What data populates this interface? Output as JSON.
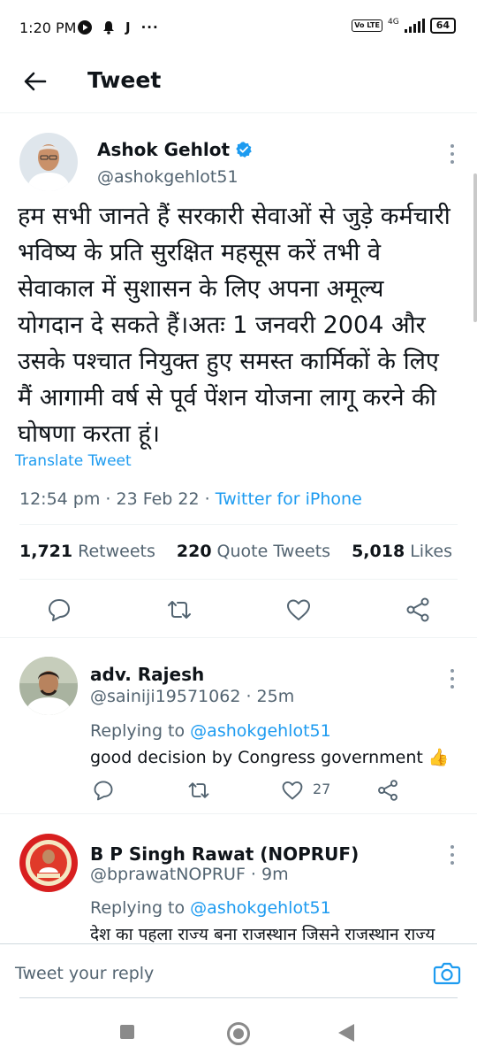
{
  "status_bar": {
    "time": "1:20 PM",
    "left_icons": [
      "play-icon",
      "bell-icon",
      "j-icon",
      "more-dots"
    ],
    "j_glyph": "J",
    "dots": "···",
    "network": "4G",
    "volte": "Vo LTE",
    "battery": "64"
  },
  "header": {
    "title": "Tweet"
  },
  "main_tweet": {
    "author_name": "Ashok Gehlot",
    "handle": "@ashokgehlot51",
    "verified": true,
    "text": "हम सभी जानते हैं सरकारी सेवाओं से जुड़े कर्मचारी भविष्य के प्रति सुरक्षित महसूस करें तभी वे सेवाकाल में सुशासन के लिए अपना अमूल्य योगदान दे सकते हैं।अतः 1 जनवरी 2004 और उसके पश्चात नियुक्त हुए समस्त कार्मिकों के लिए मैं आगामी वर्ष से पूर्व पेंशन योजना लागू करने की घोषणा करता हूं।",
    "translate_label": "Translate Tweet",
    "time": "12:54 pm",
    "date": "23 Feb 22",
    "separator": "·",
    "source": "Twitter for iPhone",
    "stats": {
      "retweets_count": "1,721",
      "retweets_label": "Retweets",
      "quotes_count": "220",
      "quotes_label": "Quote Tweets",
      "likes_count": "5,018",
      "likes_label": "Likes"
    }
  },
  "replies": [
    {
      "name": "adv. Rajesh",
      "handle": "@sainiji19571062",
      "age": "25m",
      "separator": "·",
      "replying_prefix": "Replying to",
      "replying_to": "@ashokgehlot51",
      "text": "good decision by Congress government 👍",
      "like_count": "27"
    },
    {
      "name": "B P Singh Rawat (NOPRUF)",
      "handle": "@bprawatNOPRUF",
      "age": "9m",
      "separator": "·",
      "replying_prefix": "Replying to",
      "replying_to": "@ashokgehlot51",
      "text": "देश का पहला राज्य बना राजस्थान जिसने राजस्थान राज्य"
    }
  ],
  "reply_bar": {
    "placeholder": "Tweet your reply"
  },
  "colors": {
    "accent": "#1d9bf0",
    "text": "#0f1419",
    "secondary": "#536471",
    "divider": "#eff3f4"
  }
}
